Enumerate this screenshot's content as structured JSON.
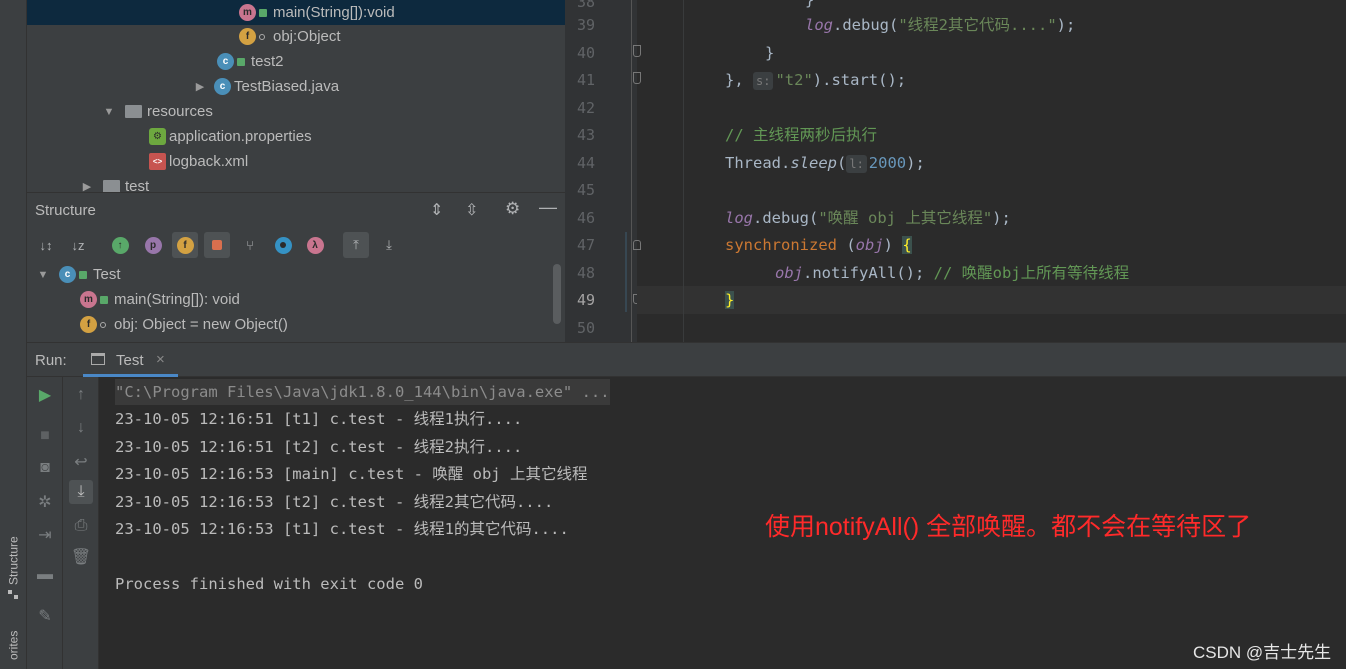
{
  "sidebar": {
    "structure_tab": "Structure",
    "favorites_tab": "orites"
  },
  "project_tree": {
    "items": [
      {
        "label": "main(String[]):void",
        "icon": "method-icon",
        "selected": true
      },
      {
        "label": "obj:Object",
        "icon": "field-icon"
      },
      {
        "label": "test2",
        "icon": "class-icon"
      },
      {
        "label": "TestBiased.java",
        "icon": "class-icon"
      },
      {
        "label": "resources",
        "icon": "folder-icon"
      },
      {
        "label": "application.properties",
        "icon": "spring-properties-icon"
      },
      {
        "label": "logback.xml",
        "icon": "xml-file-icon"
      },
      {
        "label": "test",
        "icon": "folder-icon"
      }
    ]
  },
  "structure": {
    "title": "Structure",
    "tree": [
      {
        "label": "Test",
        "icon": "class-icon"
      },
      {
        "label": "main(String[]): void",
        "icon": "method-icon"
      },
      {
        "label": "obj: Object = new Object()",
        "icon": "field-icon"
      }
    ],
    "toolbar_icons": {
      "sort_alpha": "ⓘ",
      "m": "m",
      "p": "p",
      "f": "f",
      "lambda": "λ"
    }
  },
  "editor": {
    "line_numbers": [
      "38",
      "39",
      "40",
      "41",
      "42",
      "43",
      "44",
      "45",
      "46",
      "47",
      "48",
      "49",
      "50"
    ],
    "current_line": "49",
    "code": {
      "l38": "}",
      "l39_obj": "log",
      "l39_method": ".debug(",
      "l39_str": "\"线程2其它代码....\"",
      "l39_end": ");",
      "l40": "}",
      "l41_a": "},",
      "l41_hint": "s:",
      "l41_str": "\"t2\"",
      "l41_end": ").start();",
      "l43": "// 主线程两秒后执行",
      "l44_a": "Thread.",
      "l44_method": "sleep",
      "l44_paren": "(",
      "l44_hint": "l:",
      "l44_num": "2000",
      "l44_end": ");",
      "l46_obj": "log",
      "l46_method": ".debug(",
      "l46_str": "\"唤醒 obj 上其它线程\"",
      "l46_end": ");",
      "l47_kw": "synchronized",
      "l47_open": " (",
      "l47_obj": "obj",
      "l47_close": ") ",
      "l47_brace": "{",
      "l48_obj": "obj",
      "l48_call": ".notifyAll();",
      "l48_comment": " // 唤醒obj上所有等待线程",
      "l49": "}"
    }
  },
  "run": {
    "label": "Run:",
    "tab_label": "Test",
    "console_lines": [
      "\"C:\\Program Files\\Java\\jdk1.8.0_144\\bin\\java.exe\" ...",
      "23-10-05 12:16:51 [t1] c.test - 线程1执行....",
      "23-10-05 12:16:51 [t2] c.test - 线程2执行....",
      "23-10-05 12:16:53 [main] c.test - 唤醒 obj 上其它线程",
      "23-10-05 12:16:53 [t2] c.test - 线程2其它代码....",
      "23-10-05 12:16:53 [t1] c.test - 线程1的其它代码....",
      "",
      "Process finished with exit code 0"
    ]
  },
  "annotation": "使用notifyAll() 全部唤醒。都不会在等待区了",
  "watermark": "CSDN @吉士先生",
  "colors": {
    "annotation": "#ff2a2a",
    "keyword": "#cc7832",
    "string": "#6a8759",
    "comment": "#629755",
    "number": "#6897bb",
    "field": "#9876aa"
  }
}
